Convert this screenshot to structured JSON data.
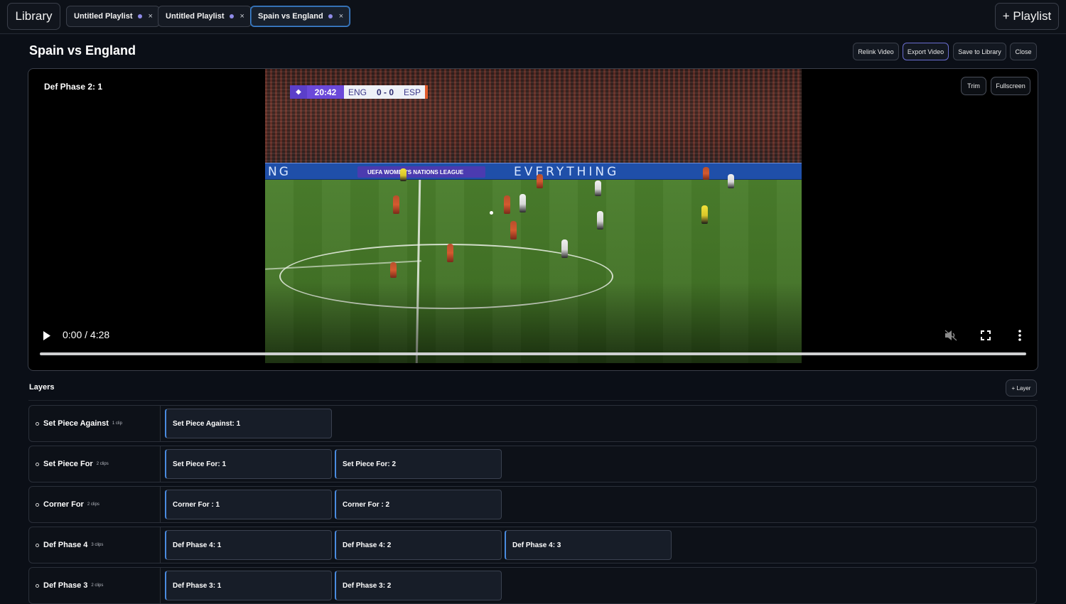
{
  "topbar": {
    "library_label": "Library",
    "tabs": [
      {
        "label": "Untitled Playlist",
        "close": "×"
      },
      {
        "label": "Untitled Playlist",
        "close": "×"
      },
      {
        "label": "Spain vs England",
        "close": "×"
      }
    ],
    "add_playlist_label": "+ Playlist"
  },
  "header": {
    "title": "Spain vs England",
    "buttons": {
      "relink": "Relink Video",
      "export": "Export Video",
      "save": "Save to Library",
      "close": "Close"
    }
  },
  "video": {
    "clip_label": "Def Phase 2: 1",
    "trim_label": "Trim",
    "fullscreen_label": "Fullscreen",
    "time_display": "0:00 / 4:28",
    "progress_fraction": 0,
    "scorebug": {
      "clock": "20:42",
      "home": "ENG",
      "score": "0 - 0",
      "away": "ESP"
    },
    "adboard_text": "EVERYTHING",
    "adboard_left": "NG",
    "adboard_sign": "UEFA WOMEN'S NATIONS LEAGUE",
    "icons": [
      "play-icon",
      "volume-icon",
      "fullscreen-icon",
      "more-icon"
    ]
  },
  "layers": {
    "title": "Layers",
    "add_label": "+ Layer",
    "rows": [
      {
        "name": "Set Piece Against",
        "count": "1 clip",
        "clips": [
          "Set Piece Against: 1"
        ]
      },
      {
        "name": "Set Piece For",
        "count": "2 clips",
        "clips": [
          "Set Piece For: 1",
          "Set Piece For: 2"
        ]
      },
      {
        "name": "Corner For",
        "count": "2 clips",
        "clips": [
          "Corner For : 1",
          "Corner For : 2"
        ]
      },
      {
        "name": "Def Phase 4",
        "count": "3 clips",
        "clips": [
          "Def Phase 4: 1",
          "Def Phase 4: 2",
          "Def Phase 4: 3"
        ]
      },
      {
        "name": "Def Phase 3",
        "count": "2 clips",
        "clips": [
          "Def Phase 3: 1",
          "Def Phase 3: 2"
        ]
      }
    ]
  },
  "colors": {
    "background": "#0b0f17",
    "accent_blue": "#3f86d6",
    "tab_dot": "#8f8be8",
    "scorebug_purple": "#6b49d9"
  }
}
